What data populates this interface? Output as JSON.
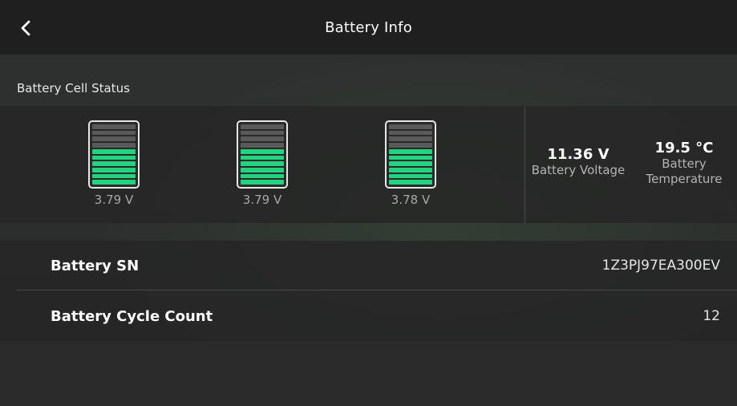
{
  "header": {
    "title": "Battery Info",
    "back_icon": "chevron-left-icon"
  },
  "cell_status": {
    "section_label": "Battery Cell Status",
    "cells": [
      {
        "voltage": "3.79 V",
        "level_segments_on": 6,
        "segments_total": 10
      },
      {
        "voltage": "3.79 V",
        "level_segments_on": 6,
        "segments_total": 10
      },
      {
        "voltage": "3.78 V",
        "level_segments_on": 6,
        "segments_total": 10
      }
    ],
    "battery_voltage": {
      "value": "11.36 V",
      "label": "Battery Voltage"
    },
    "battery_temperature": {
      "value": "19.5 °C",
      "label_line1": "Battery",
      "label_line2": "Temperature"
    }
  },
  "info": {
    "rows": [
      {
        "label": "Battery SN",
        "value": "1Z3PJ97EA300EV"
      },
      {
        "label": "Battery Cycle Count",
        "value": "12"
      }
    ]
  },
  "colors": {
    "cell_fill": "#22d47f",
    "cell_empty": "#5a5a5a",
    "header_bg": "#1f1f1f"
  }
}
